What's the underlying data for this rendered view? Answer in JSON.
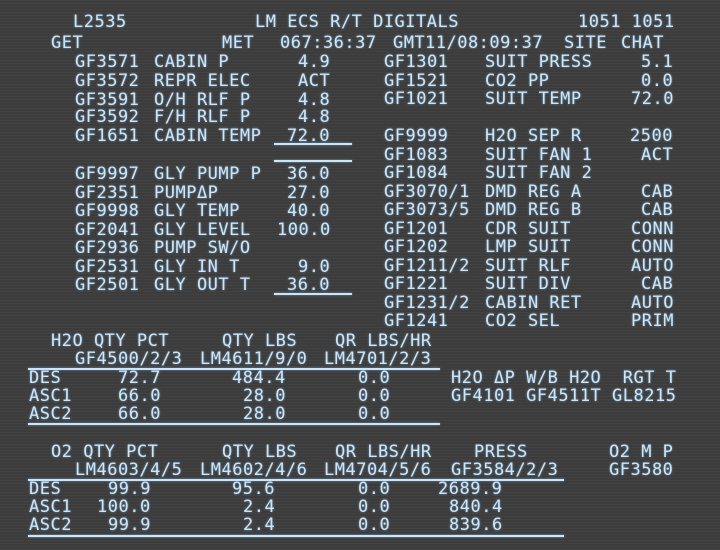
{
  "header": {
    "display_id": "L2535",
    "title": "LM ECS R/T DIGITALS",
    "site_ids": "1051 1051",
    "get_label": "GET",
    "met_label": "MET",
    "met_value": "067:36:37",
    "gmt_label": "GMT",
    "gmt_value": "11/08:09:37",
    "site_label": "SITE",
    "site_value": "CHAT"
  },
  "left_params": [
    {
      "id": "GF3571",
      "name": "CABIN P",
      "value": "4.9"
    },
    {
      "id": "GF3572",
      "name": "REPR ELEC",
      "value": "ACT"
    },
    {
      "id": "GF3591",
      "name": "O/H RLF P",
      "value": "4.8"
    },
    {
      "id": "GF3592",
      "name": "F/H RLF P",
      "value": "4.8"
    },
    {
      "id": "GF1651",
      "name": "CABIN TEMP",
      "value": "72.0"
    },
    {
      "id": "GF9997",
      "name": "GLY PUMP P",
      "value": "36.0"
    },
    {
      "id": "GF2351",
      "name": "PUMPΔP",
      "value": "27.0"
    },
    {
      "id": "GF9998",
      "name": "GLY TEMP",
      "value": "40.0"
    },
    {
      "id": "GF2041",
      "name": "GLY LEVEL",
      "value": "100.0"
    },
    {
      "id": "GF2936",
      "name": "PUMP SW/O",
      "value": ""
    },
    {
      "id": "GF2531",
      "name": "GLY IN T",
      "value": "9.0"
    },
    {
      "id": "GF2501",
      "name": "GLY OUT T",
      "value": "36.0"
    }
  ],
  "right_params": [
    {
      "id": "GF1301",
      "name": "SUIT PRESS",
      "value": "5.1"
    },
    {
      "id": "GF1521",
      "name": "CO2 PP",
      "value": "0.0"
    },
    {
      "id": "GF1021",
      "name": "SUIT TEMP",
      "value": "72.0"
    },
    {
      "id": "GF9999",
      "name": "H2O SEP R",
      "value": "2500"
    },
    {
      "id": "GF1083",
      "name": "SUIT FAN 1",
      "value": "ACT"
    },
    {
      "id": "GF1084",
      "name": "SUIT FAN 2",
      "value": ""
    },
    {
      "id": "GF3070/1",
      "name": "DMD REG A",
      "value": "CAB"
    },
    {
      "id": "GF3073/5",
      "name": "DMD REG B",
      "value": "CAB"
    },
    {
      "id": "GF1201",
      "name": "CDR SUIT",
      "value": "CONN"
    },
    {
      "id": "GF1202",
      "name": "LMP SUIT",
      "value": "CONN"
    },
    {
      "id": "GF1211/2",
      "name": "SUIT RLF",
      "value": "AUTO"
    },
    {
      "id": "GF1221",
      "name": "SUIT DIV",
      "value": "CAB"
    },
    {
      "id": "GF1231/2",
      "name": "CABIN RET",
      "value": "AUTO"
    },
    {
      "id": "GF1241",
      "name": "CO2 SEL",
      "value": "PRIM"
    }
  ],
  "h2o": {
    "headers": {
      "qty_pct": "H2O QTY PCT",
      "qty_lbs": "QTY LBS",
      "qr": "QR LBS/HR"
    },
    "ids": {
      "qty_pct": "GF4500/2/3",
      "qty_lbs": "LM4611/9/0",
      "qr": "LM4701/2/3"
    },
    "rows": [
      {
        "label": "DES",
        "pct": "72.7",
        "lbs": "484.4",
        "qr": "0.0"
      },
      {
        "label": "ASC1",
        "pct": "66.0",
        "lbs": "28.0",
        "qr": "0.0"
      },
      {
        "label": "ASC2",
        "pct": "66.0",
        "lbs": "28.0",
        "qr": "0.0"
      }
    ],
    "aux_header": "H2O ΔP W/B H2O  RGT T",
    "aux_ids": "GF4101 GF4511T GL8215"
  },
  "o2": {
    "headers": {
      "qty_pct": "O2 QTY PCT",
      "qty_lbs": "QTY LBS",
      "qr": "QR LBS/HR",
      "press": "PRESS",
      "mp": "O2 M P"
    },
    "ids": {
      "qty_pct": "LM4603/4/5",
      "qty_lbs": "LM4602/4/6",
      "qr": "LM4704/5/6",
      "press": "GF3584/2/3",
      "mp": "GF3580"
    },
    "rows": [
      {
        "label": "DES",
        "pct": "99.9",
        "lbs": "95.6",
        "qr": "0.0",
        "press": "2689.9"
      },
      {
        "label": "ASC1",
        "pct": "100.0",
        "lbs": "2.4",
        "qr": "0.0",
        "press": "840.4"
      },
      {
        "label": "ASC2",
        "pct": "99.9",
        "lbs": "2.4",
        "qr": "0.0",
        "press": "839.6"
      }
    ]
  },
  "colors": {
    "background": "#3c3c3c",
    "text": "#c9e6fb"
  }
}
